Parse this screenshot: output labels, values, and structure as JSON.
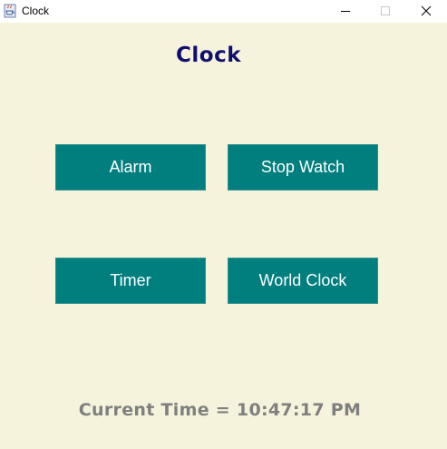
{
  "window": {
    "title": "Clock",
    "app_icon": "java-cup-icon",
    "controls": {
      "minimize_icon": "minimize-icon",
      "maximize_icon": "maximize-icon",
      "close_icon": "close-icon"
    }
  },
  "main": {
    "heading": "Clock",
    "buttons": [
      {
        "label": "Alarm"
      },
      {
        "label": "Stop Watch"
      },
      {
        "label": "Timer"
      },
      {
        "label": "World Clock"
      }
    ],
    "current_time": "Current Time = 10:47:17 PM"
  },
  "colors": {
    "background": "#f5f3db",
    "button_bg": "#017f7f",
    "button_text": "#ffffff",
    "heading": "#0f0f6e",
    "time_text": "#7f7f7f"
  }
}
